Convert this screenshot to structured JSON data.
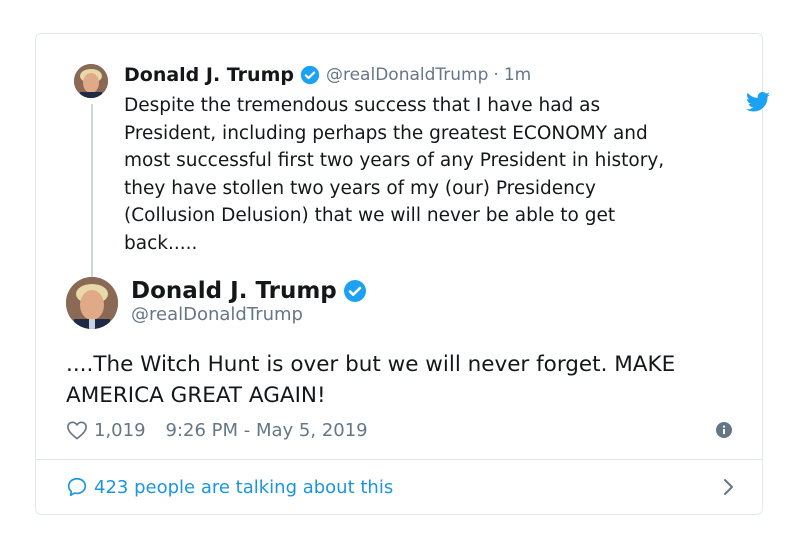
{
  "parent_tweet": {
    "name": "Donald J. Trump",
    "handle": "@realDonaldTrump",
    "separator": "·",
    "time_ago": "1m",
    "text": "Despite the tremendous success that I have had as\nPresident, including perhaps the greatest ECONOMY and\nmost successful first two years of any President in history,\nthey have stollen two years of my (our) Presidency\n(Collusion Delusion) that we will never be able to get\nback....."
  },
  "main_tweet": {
    "name": "Donald J. Trump",
    "handle": "@realDonaldTrump",
    "text": "....The Witch Hunt is over but we will never forget. MAKE AMERICA GREAT AGAIN!",
    "like_count": "1,019",
    "timestamp": "9:26 PM - May 5, 2019"
  },
  "footer": {
    "talking": "423 people are talking about this"
  },
  "colors": {
    "twitter_blue": "#1da1f2",
    "link_blue": "#1b95e0",
    "muted": "#657786",
    "border": "#e1e8ed"
  },
  "icons": {
    "bird": "twitter-bird-icon",
    "verified": "verified-badge-icon",
    "heart": "heart-icon",
    "info": "info-icon",
    "bubble": "speech-bubble-icon",
    "chevron": "chevron-right-icon"
  }
}
